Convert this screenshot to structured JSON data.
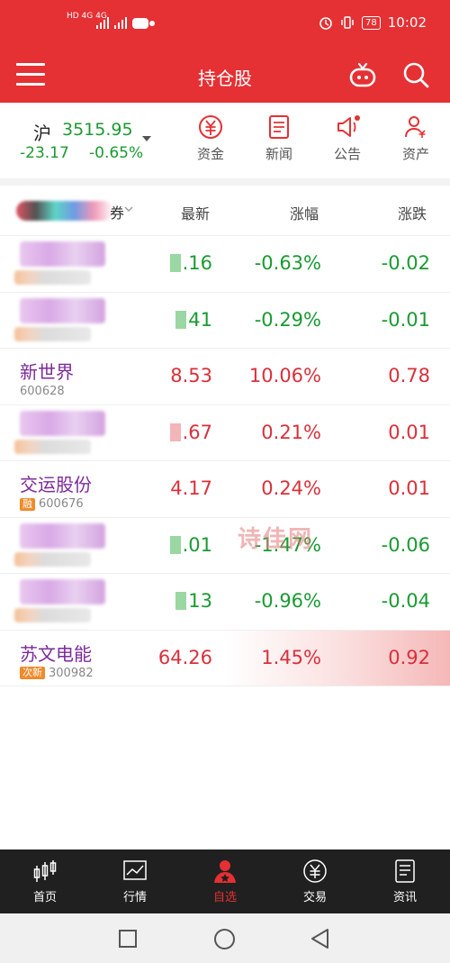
{
  "status_bar": {
    "left_icons": "HD 4G 4G",
    "battery": "78",
    "time": "10:02"
  },
  "header": {
    "title": "持仓股",
    "menu_icon": "hamburger-menu-icon",
    "robot_icon": "robot-icon",
    "search_icon": "search-icon"
  },
  "index": {
    "name": "沪",
    "value": "3515.95",
    "change": "-23.17",
    "change_pct": "-0.65%",
    "color": "#1a9a32"
  },
  "quick_buttons": [
    {
      "label": "资金",
      "icon": "yuan-circle-icon"
    },
    {
      "label": "新闻",
      "icon": "news-document-icon"
    },
    {
      "label": "公告",
      "icon": "megaphone-icon"
    },
    {
      "label": "资产",
      "icon": "person-yuan-icon"
    }
  ],
  "table": {
    "group_label": "券",
    "columns": [
      "最新",
      "涨幅",
      "涨跌"
    ],
    "rows": [
      {
        "name": "",
        "code": "",
        "latest": ".16",
        "pct": "-0.63%",
        "chg": "-0.02",
        "dir": "down",
        "masked": true
      },
      {
        "name": "",
        "code": "",
        "latest": "41",
        "pct": "-0.29%",
        "chg": "-0.01",
        "dir": "down",
        "masked": true
      },
      {
        "name": "新世界",
        "code": "600628",
        "tag": "",
        "latest": "8.53",
        "pct": "10.06%",
        "chg": "0.78",
        "dir": "up",
        "masked": false
      },
      {
        "name": "",
        "code": "",
        "latest": ".67",
        "pct": "0.21%",
        "chg": "0.01",
        "dir": "up",
        "masked": true
      },
      {
        "name": "交运股份",
        "code": "600676",
        "tag": "融",
        "latest": "4.17",
        "pct": "0.24%",
        "chg": "0.01",
        "dir": "up",
        "masked": false
      },
      {
        "name": "",
        "code": "",
        "latest": ".01",
        "pct": "-1.47%",
        "chg": "-0.06",
        "dir": "down",
        "masked": true
      },
      {
        "name": "",
        "code": "",
        "latest": "13",
        "pct": "-0.96%",
        "chg": "-0.04",
        "dir": "down",
        "masked": true
      },
      {
        "name": "苏文电能",
        "code": "300982",
        "tag": "次新",
        "latest": "64.26",
        "pct": "1.45%",
        "chg": "0.92",
        "dir": "up",
        "masked": false,
        "highlight": true
      }
    ]
  },
  "watermark": "诗佳网",
  "bottom_nav": [
    {
      "label": "首页",
      "icon": "candlestick-icon"
    },
    {
      "label": "行情",
      "icon": "line-chart-icon"
    },
    {
      "label": "自选",
      "icon": "user-star-icon",
      "active": true
    },
    {
      "label": "交易",
      "icon": "yuan-coin-icon"
    },
    {
      "label": "资讯",
      "icon": "document-icon"
    }
  ],
  "colors": {
    "brand_red": "#e53034",
    "up": "#d9303a",
    "down": "#1a9a32",
    "name_purple": "#7b2a9a"
  }
}
